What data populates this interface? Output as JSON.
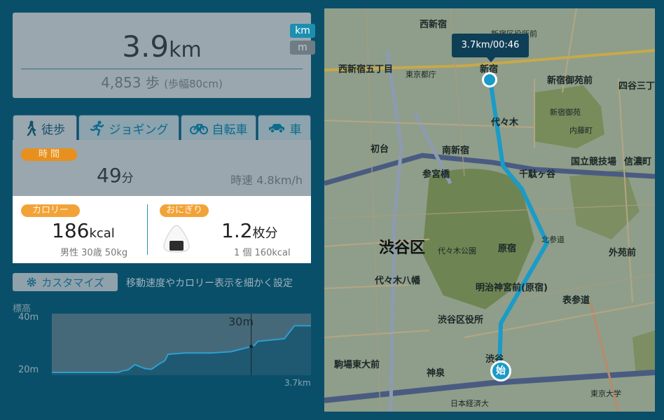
{
  "distance": {
    "value": "3.9",
    "unit": "km",
    "unit_options": [
      "km",
      "m"
    ],
    "steps": "4,853 歩",
    "stride": "(歩幅80cm)"
  },
  "tabs": [
    {
      "label": "徒歩",
      "icon": "walk-icon",
      "active": true
    },
    {
      "label": "ジョギング",
      "icon": "jogging-icon",
      "active": false
    },
    {
      "label": "自転車",
      "icon": "bicycle-icon",
      "active": false
    },
    {
      "label": "車",
      "icon": "car-icon",
      "active": false
    }
  ],
  "time": {
    "label": "時 間",
    "value": "49",
    "unit": "分",
    "speed": "時速 4.8km/h"
  },
  "calorie": {
    "label": "カロリー",
    "value": "186",
    "unit": "kcal",
    "sub": "男性 30歳 50kg"
  },
  "onigiri": {
    "label": "おにぎり",
    "icon": "onigiri-icon",
    "value": "1.2",
    "unit": "枚分",
    "sub": "1 個 160kcal"
  },
  "customize": {
    "button_label": "カスタマイズ",
    "description": "移動速度やカロリー表示を細かく設定"
  },
  "elevation": {
    "title": "標高",
    "max_label": "40m",
    "min_label": "20m",
    "marker_label": "30m",
    "distance_label": "3.7km"
  },
  "chart_data": {
    "type": "area",
    "title": "標高",
    "xlabel": "",
    "ylabel": "",
    "xlim": [
      0,
      3.9
    ],
    "ylim": [
      20,
      40
    ],
    "x": [
      0,
      0.5,
      1.0,
      1.05,
      1.15,
      1.25,
      1.3,
      1.4,
      1.5,
      1.6,
      1.7,
      1.75,
      2.0,
      2.2,
      2.4,
      2.7,
      3.0,
      3.05,
      3.1,
      3.3,
      3.5,
      3.65,
      3.75,
      3.9
    ],
    "values": [
      20,
      20,
      20,
      20.5,
      21,
      23,
      22.5,
      21.5,
      21.2,
      23,
      24.5,
      27,
      27.5,
      27.5,
      27.5,
      28,
      30,
      30.5,
      32,
      32.5,
      33,
      38,
      38,
      38
    ],
    "marker_x": 3.0,
    "marker_value": 30,
    "grid": false
  },
  "map": {
    "tooltip": "3.7km/00:46",
    "start_label": "始",
    "ward_label": "渋谷区",
    "labels": [
      "西新宿",
      "新宿区役所前",
      "西新宿五丁目",
      "東京都庁",
      "新宿",
      "新宿御苑前",
      "四谷三丁目",
      "代々木",
      "新宿御苑",
      "内藤町",
      "初台",
      "南新宿",
      "国立競技場",
      "信濃町",
      "参宮橋",
      "千駄ヶ谷",
      "北参道",
      "代々木公園",
      "原宿",
      "外苑前",
      "代々木八幡",
      "明治神宮前(原宿)",
      "表参道",
      "渋谷区役所",
      "駒場東大前",
      "神泉",
      "渋谷",
      "東京大学",
      "日本経済大"
    ],
    "route_color": "#1a9bc8"
  }
}
